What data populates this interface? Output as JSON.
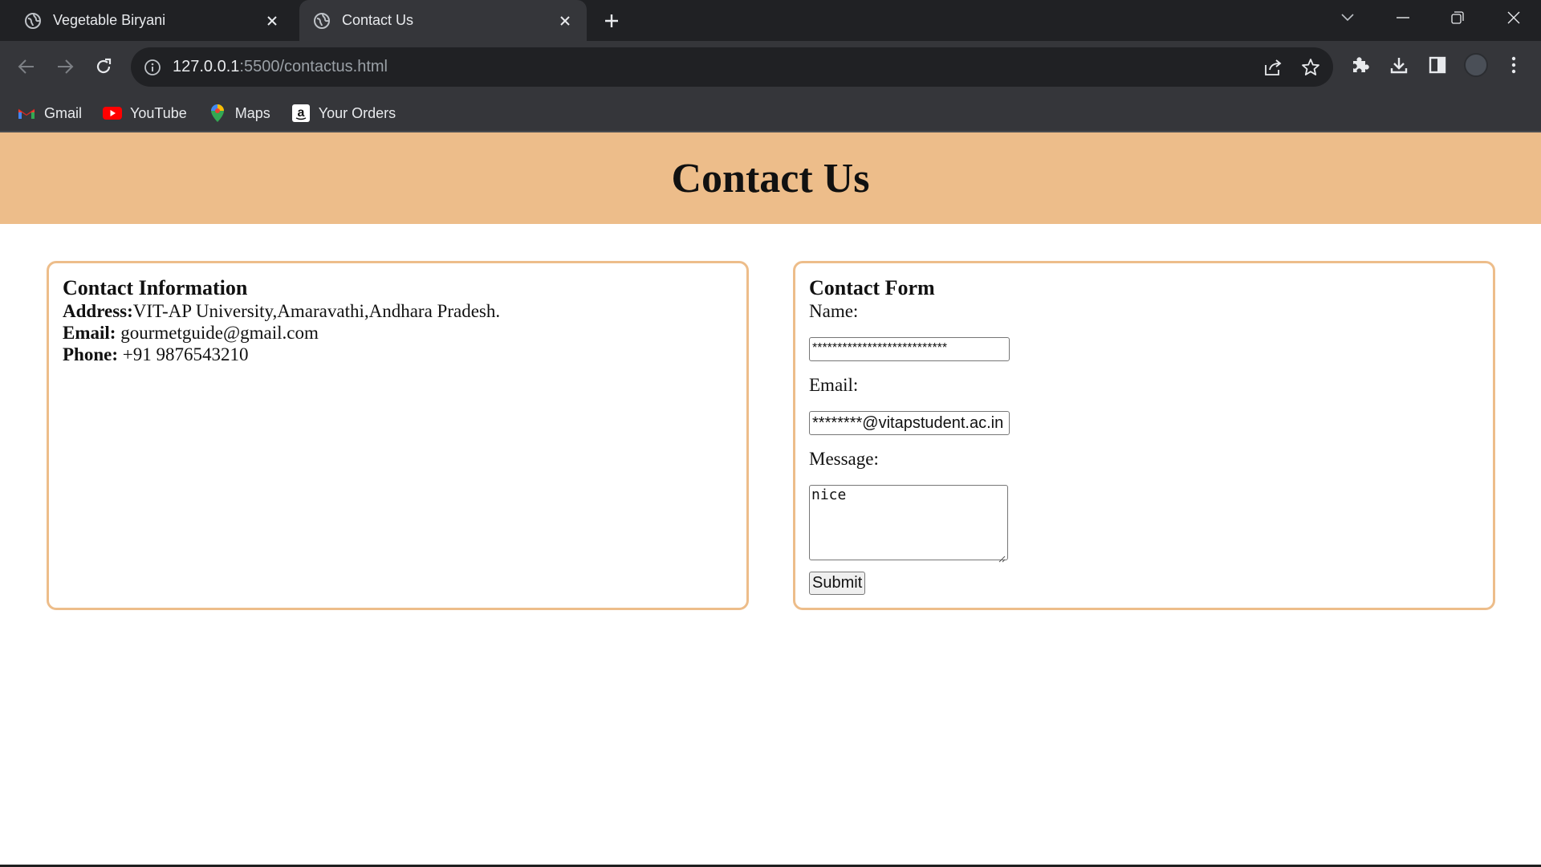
{
  "browser": {
    "tabs": [
      {
        "title": "Vegetable Biryani",
        "active": false,
        "icon": "globe-icon"
      },
      {
        "title": "Contact Us",
        "active": true,
        "icon": "globe-icon"
      }
    ],
    "address": {
      "host": "127.0.0.1",
      "path": ":5500/contactus.html"
    },
    "bookmarks": [
      {
        "label": "Gmail",
        "icon": "gmail-icon"
      },
      {
        "label": "YouTube",
        "icon": "youtube-icon"
      },
      {
        "label": "Maps",
        "icon": "maps-icon"
      },
      {
        "label": "Your Orders",
        "icon": "amazon-icon"
      }
    ]
  },
  "page": {
    "title": "Contact Us",
    "info": {
      "heading": "Contact Information",
      "address_label": "Address:",
      "address_value": "VIT-AP University,Amaravathi,Andhara Pradesh.",
      "email_label": "Email:",
      "email_value": "gourmetguide@gmail.com",
      "phone_label": "Phone:",
      "phone_value": "+91 9876543210"
    },
    "form": {
      "heading": "Contact Form",
      "name_label": "Name:",
      "name_value": "***************************",
      "email_label": "Email:",
      "email_value": "********@vitapstudent.ac.in",
      "message_label": "Message:",
      "message_value": "nice",
      "submit_label": "Submit"
    }
  },
  "colors": {
    "accent": "#edbd8a",
    "chrome_dark": "#202124",
    "chrome_toolbar": "#35363a"
  }
}
